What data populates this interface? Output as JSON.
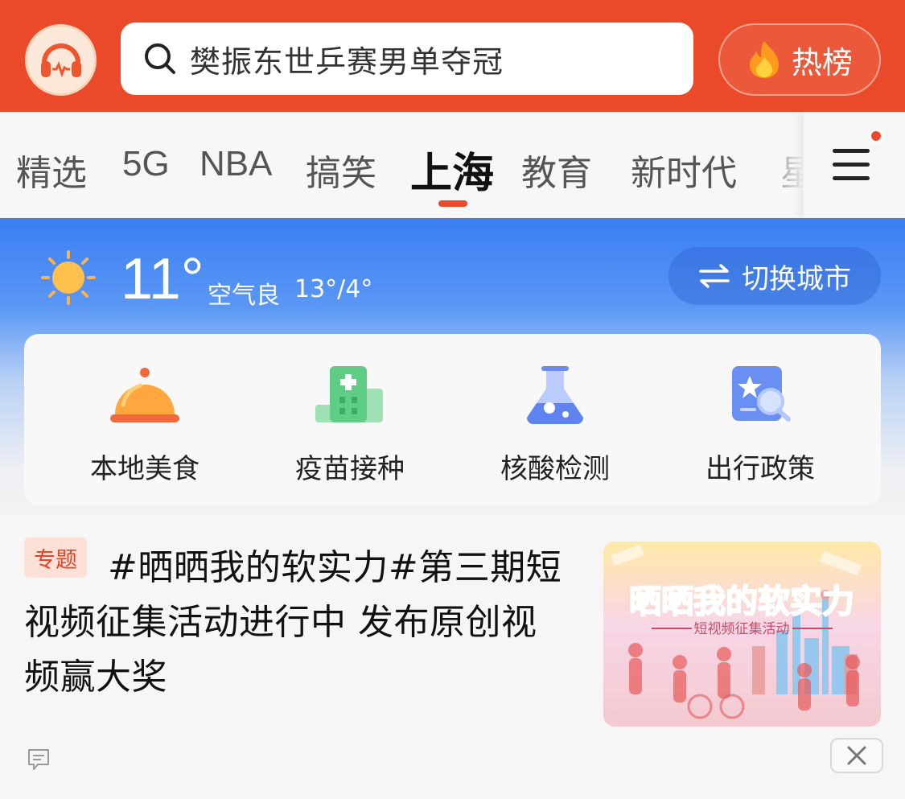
{
  "header": {
    "logo_icon": "headphones-icon",
    "search_placeholder": "樊振东世乒赛男单夺冠",
    "hot_label": "热榜",
    "accent": "#ea4a2a"
  },
  "tabs": {
    "items": [
      "精选",
      "5G",
      "NBA",
      "搞笑",
      "上海",
      "教育",
      "新时代",
      "星"
    ],
    "active": "上海",
    "has_notification": true
  },
  "weather": {
    "temperature": "11°",
    "air": "空气良",
    "range": "13°/4°",
    "switch_label": "切换城市",
    "icon": "sun-icon"
  },
  "quick_links": [
    {
      "label": "本地美食",
      "icon": "food-cloche-icon"
    },
    {
      "label": "疫苗接种",
      "icon": "hospital-icon"
    },
    {
      "label": "核酸检测",
      "icon": "flask-icon"
    },
    {
      "label": "出行政策",
      "icon": "search-star-icon"
    }
  ],
  "feed": {
    "items": [
      {
        "tag": "专题",
        "title": "#晒晒我的软实力#第三期短视频征集活动进行中 发布原创视频赢大奖",
        "thumb_title": "晒晒我的软实力",
        "thumb_subtitle": "短视频征集活动"
      }
    ]
  }
}
